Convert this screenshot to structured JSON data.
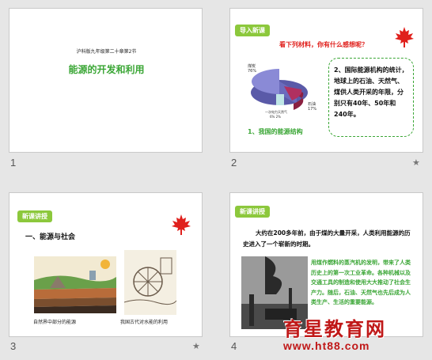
{
  "slides": [
    {
      "number": "1",
      "subtitle": "沪科版九年级第二十章第2节",
      "title": "能源的开发和利用"
    },
    {
      "number": "2",
      "tag": "导入新课",
      "question": "看下列材料，你有什么感想呢？",
      "pie_labels": {
        "coal": "煤炭\n76%",
        "oil": "石油\n17%",
        "gas": "天然气\n2%",
        "hydro": "水电\n5%",
        "other": "一次电力天然气"
      },
      "callout": "2、国际能源机构的统计，地球上的石油、天然气、煤供人类开采的年限，分别只有40年、50年和240年。",
      "caption": "1、我国的能源结构"
    },
    {
      "number": "3",
      "tag": "新课讲授",
      "heading": "一、能源与社会",
      "caption_left": "自然界中部分的能源",
      "caption_right": "我国古代对水能的利用"
    },
    {
      "number": "4",
      "tag": "新课讲授",
      "paragraph": "大约在200多年前，由于煤的大量开采，人类利用能源的历史进入了一个崭新的时期。",
      "green_text": "用煤作燃料的蒸汽机的发明，带来了人类历史上的第一次工业革命。各种机械以及交通工具的制造和使用大大推动了社会生产力。随后，石油、天然气也先后成为人类生产、生活的重要能源。"
    }
  ],
  "watermark": {
    "line1": "育星教育网",
    "line2": "www.ht88.com"
  },
  "colors": {
    "green": "#3aa635",
    "red": "#e0201c",
    "tag": "#8cc83c"
  }
}
